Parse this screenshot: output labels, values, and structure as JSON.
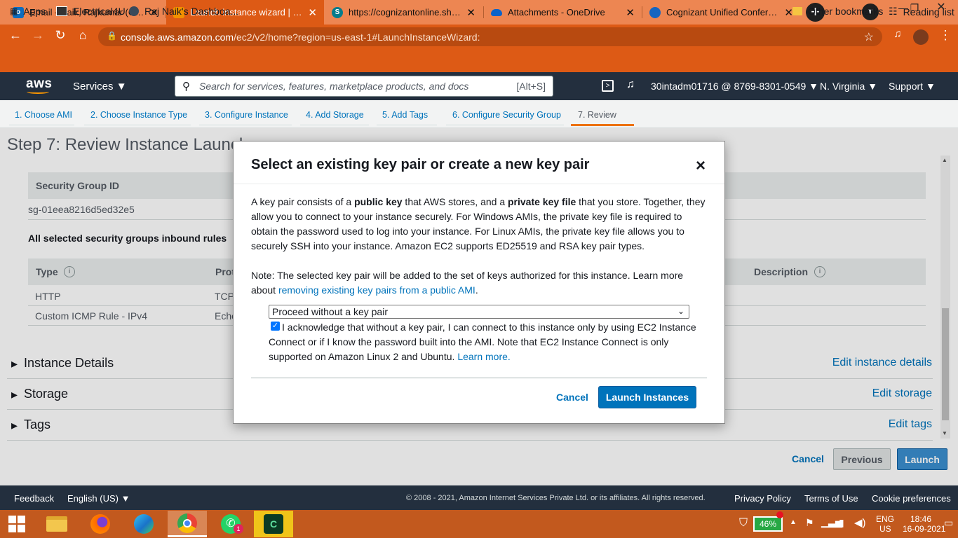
{
  "browser": {
    "tabs": [
      {
        "title": "Email - Naik, Rajkumar (Cogniz",
        "icon": "outlook-icon",
        "color": "#0f6cbd"
      },
      {
        "title": "Launch instance wizard | EC2 M",
        "icon": "aws-box-icon",
        "color": "#f29100"
      },
      {
        "title": "https://cognizantonline.sharep",
        "icon": "sharepoint-icon",
        "color": "#037c8c"
      },
      {
        "title": "Attachments - OneDrive",
        "icon": "onedrive-icon",
        "color": "#0a63c9"
      },
      {
        "title": "Cognizant Unified Conferencin",
        "icon": "webex-icon",
        "color": "#1565c0"
      }
    ],
    "new_tab": "+",
    "url_host": "console.aws.amazon.com",
    "url_path": "/ec2/v2/home?region=us-east-1#LaunchInstanceWizard:",
    "bookmarks": [
      "Apps",
      "Electrical4U",
      "Raj Naik's Dashboa..."
    ],
    "other_bookmarks": "Other bookmarks",
    "reading_list": "Reading list"
  },
  "aws_header": {
    "logo": "aws",
    "services": "Services",
    "search_placeholder": "Search for services, features, marketplace products, and docs",
    "search_shortcut": "[Alt+S]",
    "account": "30intadm01716 @ 8769-8301-0549",
    "region": "N. Virginia",
    "support": "Support"
  },
  "wizard": {
    "steps": [
      "1. Choose AMI",
      "2. Choose Instance Type",
      "3. Configure Instance",
      "4. Add Storage",
      "5. Add Tags",
      "6. Configure Security Group",
      "7. Review"
    ],
    "title": "Step 7: Review Instance Launch"
  },
  "review": {
    "sg_id_header": "Security Group ID",
    "sg_id_value": "sg-01eea8216d5ed32e5",
    "inbound_title": "All selected security groups inbound rules",
    "rules_headers": {
      "type": "Type",
      "protocol": "Protocol",
      "description": "Description"
    },
    "rules": [
      {
        "type": "HTTP",
        "protocol": "TCP"
      },
      {
        "type": "Custom ICMP Rule - IPv4",
        "protocol": "Echo"
      }
    ],
    "sections": [
      {
        "title": "Instance Details",
        "edit": "Edit instance details"
      },
      {
        "title": "Storage",
        "edit": "Edit storage"
      },
      {
        "title": "Tags",
        "edit": "Edit tags"
      }
    ],
    "buttons": {
      "cancel": "Cancel",
      "previous": "Previous",
      "launch": "Launch"
    }
  },
  "modal": {
    "title": "Select an existing key pair or create a new key pair",
    "close": "×",
    "desc_1": "A key pair consists of a ",
    "desc_b1": "public key",
    "desc_2": " that AWS stores, and a ",
    "desc_b2": "private key file",
    "desc_3": " that you store. Together, they allow you to connect to your instance securely. For Windows AMIs, the private key file is required to obtain the password used to log into your instance. For Linux AMIs, the private key file allows you to securely SSH into your instance. Amazon EC2 supports ED25519 and RSA key pair types.",
    "note_1": "Note: The selected key pair will be added to the set of keys authorized for this instance. Learn more about ",
    "note_link": "removing existing key pairs from a public AMI",
    "note_2": ".",
    "select_value": "Proceed without a key pair",
    "ack_checked": true,
    "ack_text": "I acknowledge that without a key pair, I can connect to this instance only by using EC2 Instance Connect or if I know the password built into the AMI. Note that EC2 Instance Connect is only supported on Amazon Linux 2 and Ubuntu. ",
    "ack_link": "Learn more.",
    "cancel": "Cancel",
    "launch": "Launch Instances"
  },
  "footer": {
    "feedback": "Feedback",
    "language": "English (US)",
    "copyright": "© 2008 - 2021, Amazon Internet Services Private Ltd. or its affiliates. All rights reserved.",
    "privacy": "Privacy Policy",
    "terms": "Terms of Use",
    "cookies": "Cookie preferences"
  },
  "taskbar": {
    "battery": "46%",
    "lang_1": "ENG",
    "lang_2": "US",
    "time": "18:46",
    "date": "16-09-2021",
    "whatsapp_badge": "1"
  }
}
